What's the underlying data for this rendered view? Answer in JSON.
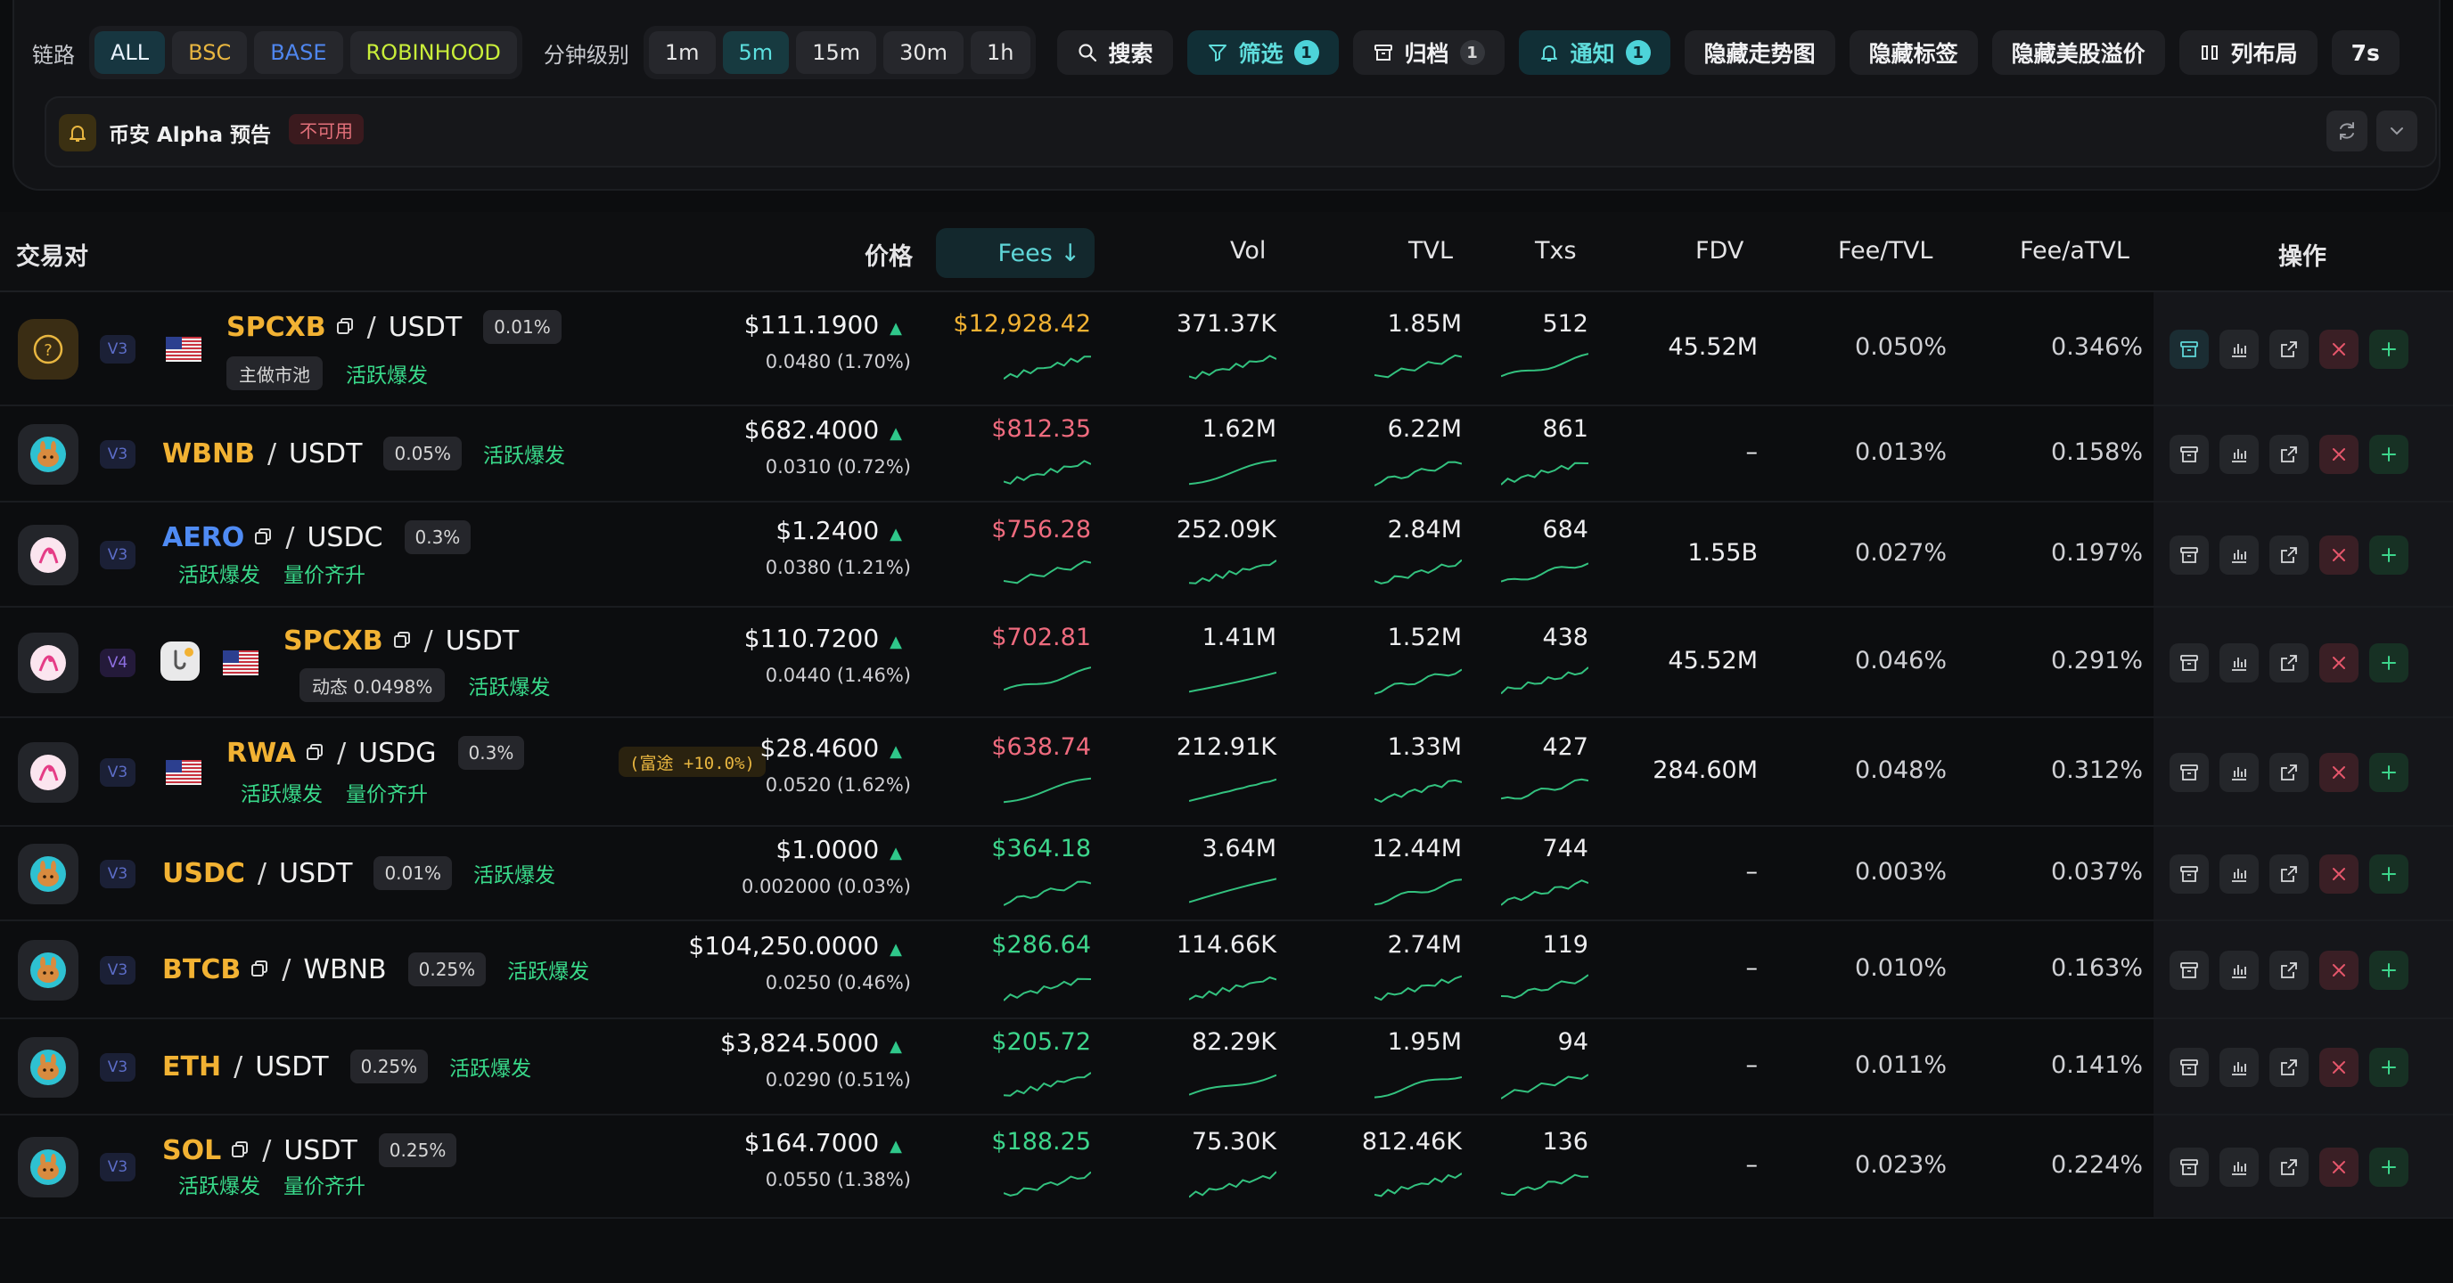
{
  "toolbar": {
    "chain_label": "链路",
    "chains": [
      "ALL",
      "BSC",
      "BASE",
      "ROBINHOOD"
    ],
    "interval_label": "分钟级别",
    "intervals": [
      "1m",
      "5m",
      "15m",
      "30m",
      "1h"
    ],
    "active_interval": "5m",
    "search_label": "搜索",
    "filter_label": "筛选",
    "filter_count": "1",
    "archive_label": "归档",
    "archive_count": "1",
    "notify_label": "通知",
    "notify_count": "1",
    "hide_trend_label": "隐藏走势图",
    "hide_tags_label": "隐藏标签",
    "hide_premium_label": "隐藏美股溢价",
    "layout_label": "列布局",
    "refresh_label": "7s"
  },
  "alpha": {
    "title": "币安 Alpha 预告",
    "status": "不可用"
  },
  "columns": {
    "pair": "交易对",
    "price": "价格",
    "fees": "Fees ↓",
    "vol": "Vol",
    "tvl": "TVL",
    "txs": "Txs",
    "fdv": "FDV",
    "fee_tvl": "Fee/TVL",
    "fee_atvl": "Fee/aTVL",
    "ops": "操作"
  },
  "colors": {
    "accent": "#5fd6d8",
    "up": "#2fc78a",
    "fees_gold": "#f2b233",
    "fees_red": "#ef6b7e",
    "fees_green": "#3dd68c"
  },
  "rows": [
    {
      "dex": "unknown-dex",
      "version": "V3",
      "flag": "us",
      "base": "SPCXB",
      "quote": "USDT",
      "fee_tier": "0.01%",
      "tags": [
        "主做市池",
        "活跃爆发"
      ],
      "price": "$111.1900",
      "change": "0.0480 (1.70%)",
      "fees": "$12,928.42",
      "vol": "371.37K",
      "tvl": "1.85M",
      "txs": "512",
      "fdv": "45.52M",
      "fee_tvl": "0.050%",
      "fee_atvl": "0.346%"
    },
    {
      "dex": "pancakeswap",
      "version": "V3",
      "base": "WBNB",
      "quote": "USDT",
      "fee_tier": "0.05%",
      "tags": [
        "活跃爆发"
      ],
      "price": "$682.4000",
      "change": "0.0310 (0.72%)",
      "fees": "$812.35",
      "vol": "1.62M",
      "tvl": "6.22M",
      "txs": "861",
      "fdv": "–",
      "fee_tvl": "0.013%",
      "fee_atvl": "0.158%"
    },
    {
      "dex": "uniswap",
      "version": "V3",
      "base": "AERO",
      "quote": "USDC",
      "fee_tier": "0.3%",
      "tags": [
        "活跃爆发",
        "量价齐升"
      ],
      "price": "$1.2400",
      "change": "0.0380 (1.21%)",
      "fees": "$756.28",
      "vol": "252.09K",
      "tvl": "2.84M",
      "txs": "684",
      "fdv": "1.55B",
      "fee_tvl": "0.027%",
      "fee_atvl": "0.197%"
    },
    {
      "dex": "uniswap",
      "version": "V4",
      "flag": "us",
      "base": "SPCXB",
      "quote": "USDT",
      "fee_tier": "动态 0.0498%",
      "tags": [
        "活跃爆发"
      ],
      "price": "$110.7200",
      "change": "0.0440 (1.46%)",
      "fees": "$702.81",
      "vol": "1.41M",
      "tvl": "1.52M",
      "txs": "438",
      "fdv": "45.52M",
      "fee_tvl": "0.046%",
      "fee_atvl": "0.291%"
    },
    {
      "dex": "uniswap",
      "version": "V3",
      "flag": "us",
      "base": "RWA",
      "quote": "USDG",
      "fee_tier": "0.3%",
      "tags": [
        "活跃爆发",
        "量价齐升"
      ],
      "premium": "(富途 +10.0%)",
      "price": "$28.4600",
      "change": "0.0520 (1.62%)",
      "fees": "$638.74",
      "vol": "212.91K",
      "tvl": "1.33M",
      "txs": "427",
      "fdv": "284.60M",
      "fee_tvl": "0.048%",
      "fee_atvl": "0.312%"
    },
    {
      "dex": "pancakeswap",
      "version": "V3",
      "base": "USDC",
      "quote": "USDT",
      "fee_tier": "0.01%",
      "tags": [
        "活跃爆发"
      ],
      "price": "$1.0000",
      "change": "0.002000 (0.03%)",
      "fees": "$364.18",
      "vol": "3.64M",
      "tvl": "12.44M",
      "txs": "744",
      "fdv": "–",
      "fee_tvl": "0.003%",
      "fee_atvl": "0.037%"
    },
    {
      "dex": "pancakeswap",
      "version": "V3",
      "base": "BTCB",
      "quote": "WBNB",
      "fee_tier": "0.25%",
      "tags": [
        "活跃爆发"
      ],
      "price": "$104,250.0000",
      "change": "0.0250 (0.46%)",
      "fees": "$286.64",
      "vol": "114.66K",
      "tvl": "2.74M",
      "txs": "119",
      "fdv": "–",
      "fee_tvl": "0.010%",
      "fee_atvl": "0.163%"
    },
    {
      "dex": "pancakeswap",
      "version": "V3",
      "base": "ETH",
      "quote": "USDT",
      "fee_tier": "0.25%",
      "tags": [
        "活跃爆发"
      ],
      "price": "$3,824.5000",
      "change": "0.0290 (0.51%)",
      "fees": "$205.72",
      "vol": "82.29K",
      "tvl": "1.95M",
      "txs": "94",
      "fdv": "–",
      "fee_tvl": "0.011%",
      "fee_atvl": "0.141%"
    },
    {
      "dex": "pancakeswap",
      "version": "V3",
      "base": "SOL",
      "quote": "USDT",
      "fee_tier": "0.25%",
      "tags": [
        "活跃爆发",
        "量价齐升"
      ],
      "price": "$164.7000",
      "change": "0.0550 (1.38%)",
      "fees": "$188.25",
      "vol": "75.30K",
      "tvl": "812.46K",
      "txs": "136",
      "fdv": "–",
      "fee_tvl": "0.023%",
      "fee_atvl": "0.224%"
    }
  ]
}
